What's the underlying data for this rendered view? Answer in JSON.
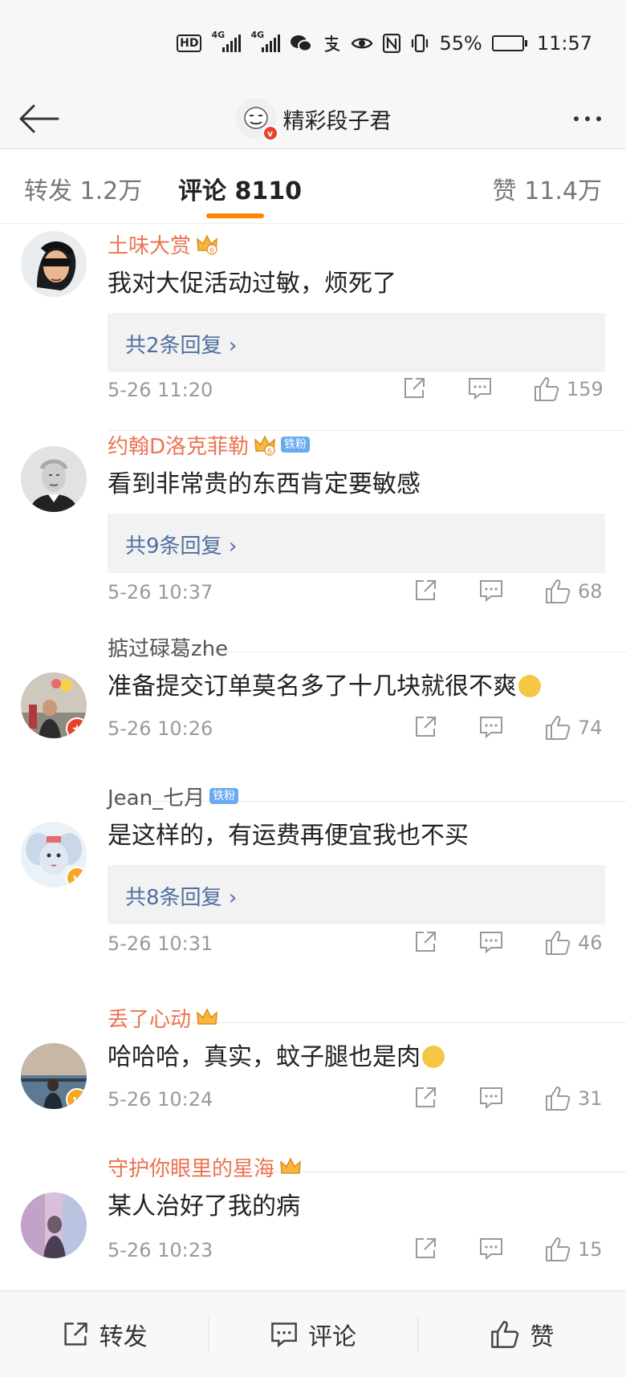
{
  "status_bar": {
    "hd": "HD",
    "net1": "4G",
    "net2": "4G",
    "battery_percent": "55%",
    "battery_level": 0.55,
    "time": "11:57",
    "icons": [
      "hd-icon",
      "signal-icon",
      "signal-icon",
      "wechat-icon",
      "alipay-icon",
      "eye-icon",
      "nfc-icon",
      "vibrate-icon",
      "battery-icon"
    ]
  },
  "nav": {
    "title": "精彩段子君",
    "back_icon": "back-arrow-icon",
    "more_icon": "more-dots-icon"
  },
  "tabs": {
    "repost": "转发 1.2万",
    "comment": "评论 8110",
    "like": "赞 11.4万",
    "active": "comment",
    "accent": "#ff8200"
  },
  "comments": [
    {
      "name": "土味大赏",
      "vip": true,
      "level": "6",
      "fan_badge": "",
      "text": "我对大促活动过敏，烦死了",
      "emoji": "",
      "replies": "共2条回复",
      "date": "5-26 11:20",
      "likes": "159"
    },
    {
      "name": "约翰D洛克菲勒",
      "vip": true,
      "level": "6",
      "fan_badge": "铁粉",
      "text": "看到非常贵的东西肯定要敏感",
      "emoji": "",
      "replies": "共9条回复",
      "date": "5-26 10:37",
      "likes": "68"
    },
    {
      "name": "掂过碌葛zhe",
      "vip": false,
      "level": "",
      "fan_badge": "",
      "text": "准备提交订单莫名多了十几块就很不爽",
      "emoji": "smirk-emoji",
      "replies": "",
      "date": "5-26 10:26",
      "likes": "74"
    },
    {
      "name": "Jean_七月",
      "vip": false,
      "level": "",
      "fan_badge": "铁粉",
      "text": "是这样的，有运费再便宜我也不买",
      "emoji": "",
      "replies": "共8条回复",
      "date": "5-26 10:31",
      "likes": "46"
    },
    {
      "name": "丢了心动",
      "vip": true,
      "level": "",
      "fan_badge": "",
      "text": "哈哈哈，真实，蚊子腿也是肉",
      "emoji": "thinking-emoji",
      "replies": "",
      "date": "5-26 10:24",
      "likes": "31"
    },
    {
      "name": "守护你眼里的星海",
      "vip": true,
      "level": "",
      "fan_badge": "",
      "text": "某人治好了我的病",
      "emoji": "",
      "replies": "",
      "date": "5-26 10:23",
      "likes": "15"
    }
  ],
  "bottom_bar": {
    "repost": "转发",
    "comment": "评论",
    "like": "赞"
  },
  "colors": {
    "vip_name": "#eb7350",
    "reply_link": "#4f6fa0",
    "fan_badge": "#6aaaf0",
    "verified_orange": "#f5a623",
    "verified_red": "#e8412c"
  }
}
